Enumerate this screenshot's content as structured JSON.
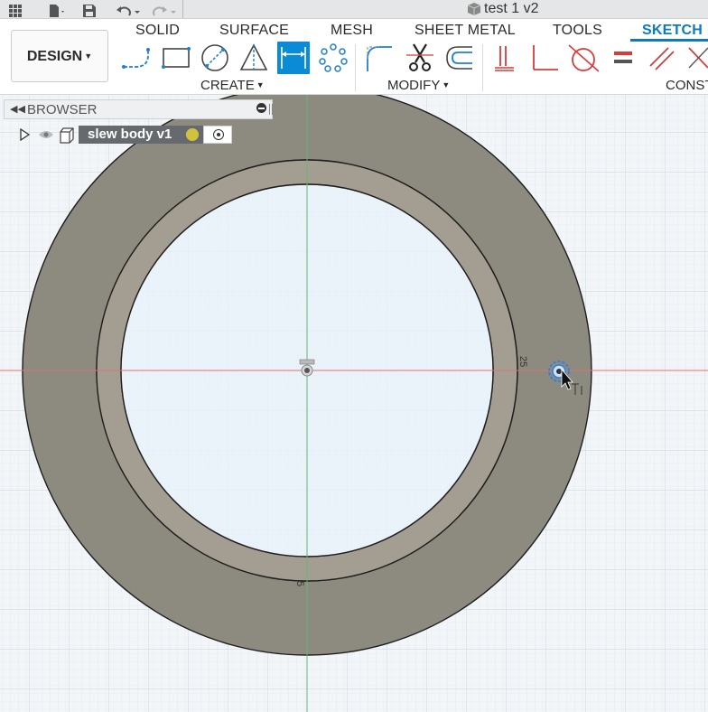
{
  "title_bar": {
    "document_title": "test 1 v2",
    "icons": [
      "grid-icon",
      "file-icon",
      "save-icon",
      "undo-icon",
      "redo-icon",
      "cube-icon"
    ]
  },
  "toolbar": {
    "workspace_button": "DESIGN",
    "tabs": [
      "SOLID",
      "SURFACE",
      "MESH",
      "SHEET METAL",
      "TOOLS",
      "SKETCH"
    ],
    "active_tab": "SKETCH",
    "groups": {
      "create": "CREATE",
      "modify": "MODIFY",
      "constraints": "CONST"
    },
    "create_tools": [
      "line-tool-icon",
      "rectangle-tool-icon",
      "circle-tool-icon",
      "triangle-tool-icon",
      "dimension-tool-icon",
      "pattern-tool-icon"
    ],
    "modify_tools": [
      "fillet-tool-icon",
      "trim-tool-icon",
      "offset-tool-icon"
    ],
    "constraint_tools": [
      "coincident-icon",
      "perpendicular-icon",
      "tangent-icon",
      "equal-icon",
      "parallel-icon"
    ]
  },
  "browser": {
    "title": "BROWSER",
    "items": [
      {
        "label": "slew body v1"
      }
    ]
  },
  "canvas": {
    "dimension_labels": [
      "25",
      "5"
    ]
  },
  "colors": {
    "accent": "#0b7ac3",
    "ring_fill": "#8d8b80",
    "inner_ring_fill": "#a39d92",
    "sketch_interior": "#e8f1fa",
    "x_axis": "#e07070",
    "y_axis": "#5dbb6e",
    "grid": "#d3dbe3"
  }
}
